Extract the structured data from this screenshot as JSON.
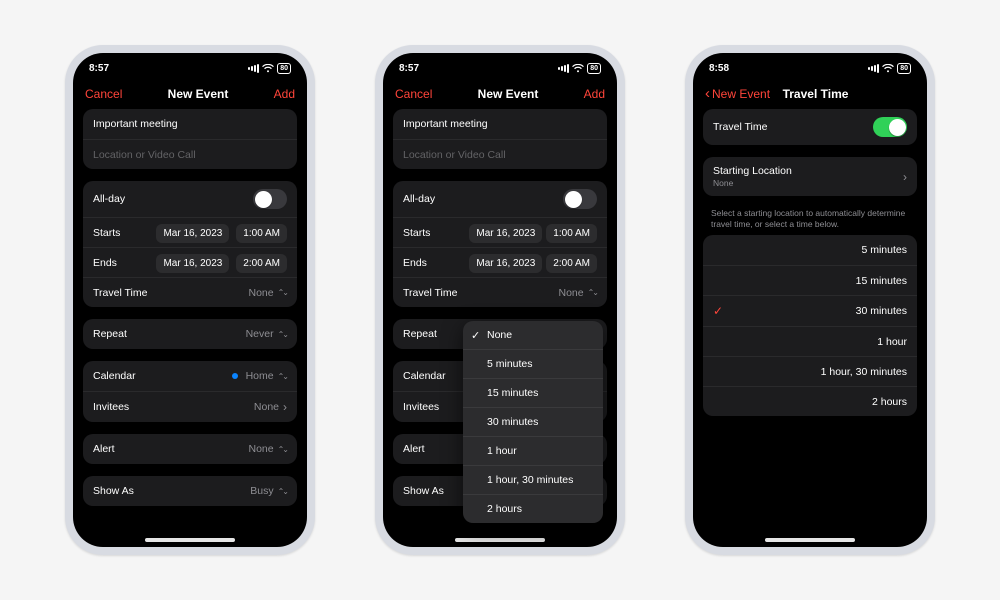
{
  "statusbar_time_a": "8:57",
  "statusbar_time_c": "8:58",
  "statusbar_battery": "80",
  "nav": {
    "cancel": "Cancel",
    "title_new_event": "New Event",
    "add": "Add",
    "back_new_event": "New Event",
    "title_travel_time": "Travel Time"
  },
  "event": {
    "title_value": "Important meeting",
    "location_placeholder": "Location or Video Call",
    "allday_label": "All-day",
    "starts_label": "Starts",
    "starts_date": "Mar 16, 2023",
    "starts_time": "1:00 AM",
    "ends_label": "Ends",
    "ends_date": "Mar 16, 2023",
    "ends_time": "2:00 AM",
    "travel_time_label": "Travel Time",
    "travel_time_value": "None",
    "repeat_label": "Repeat",
    "repeat_value": "Never",
    "calendar_label": "Calendar",
    "calendar_value": "Home",
    "invitees_label": "Invitees",
    "invitees_value": "None",
    "alert_label": "Alert",
    "alert_value": "None",
    "showas_label": "Show As",
    "showas_value": "Busy"
  },
  "travel_popup": {
    "options": [
      "None",
      "5 minutes",
      "15 minutes",
      "30 minutes",
      "1 hour",
      "1 hour, 30 minutes",
      "2 hours"
    ],
    "selected": "None"
  },
  "travel_screen": {
    "toggle_label": "Travel Time",
    "toggle_on": true,
    "start_loc_label": "Starting Location",
    "start_loc_value": "None",
    "footnote": "Select a starting location to automatically determine travel time, or select a time below.",
    "options": [
      "5 minutes",
      "15 minutes",
      "30 minutes",
      "1 hour",
      "1 hour, 30 minutes",
      "2 hours"
    ],
    "selected": "30 minutes"
  }
}
